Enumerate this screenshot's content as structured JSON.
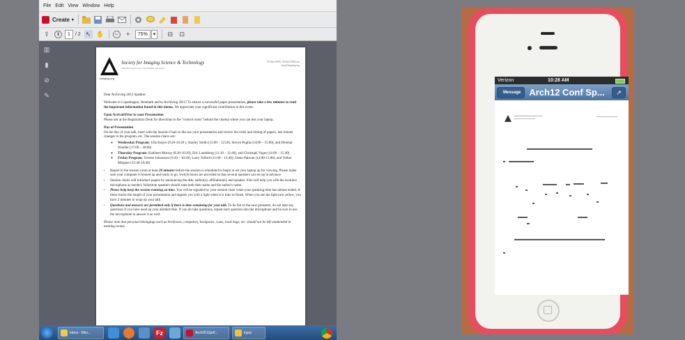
{
  "viewer": {
    "menu": [
      "File",
      "Edit",
      "View",
      "Window",
      "Help"
    ],
    "create_label": "Create",
    "page_current": "1",
    "page_total": "/ 2",
    "zoom": "75%"
  },
  "document": {
    "org_name": "Society for Imaging Science & Technology",
    "org_address": "7003 Kilworth Lane ▪ Springfield, VA 22151",
    "logo_text": "imaging.org",
    "contact_line1": "703/642-9090, 703/642-9094 fax",
    "contact_line2": "info@imaging.org",
    "salutation": "Dear Archiving 2012 Speaker:",
    "intro_pre": "Welcome to Copenhagen, Denmark and to Archiving 2012! To ensure a successful paper presentation, ",
    "intro_bold": "please take a few minutes to read the important information found in this memo.",
    "intro_post": " We appreciate your significant contribution to this event.",
    "arrival_heading": "Upon Arrival/Prior to your Presentation",
    "arrival_text": "Please ask at the Registration Desk for directions to the \"control room\" behind the cinema where you can test your laptop.",
    "day_heading": "Day of Presentation",
    "day_text": "On the day of your talk, meet with the Session Chair to discuss your presentation and review the order and timing of papers, last minute changes to the program, etc. The session chairs are:",
    "programs": [
      {
        "label": "Wednesday Program",
        "text": ": Ulla Kejser (9:20-10:20 ), Stanley Smith (11:00 – 12:20), Steven Puglia (14:00 – 15:00), and Dietmar Wueller (17:00 – 18:00)"
      },
      {
        "label": "Thursday Program",
        "text": ": Kathleen Murray (8:20-10:20), Eric Landsberg (11:10 – 12:40), and Christoph Voges (14:00 – 15:40)"
      },
      {
        "label": "Friday Program",
        "text": ": Torsten Johansson (9:20 – 10:20), Larry Telford (11:00 – 12:40), Osmo Paloran (14:00-15:00), and Volker Märgner (15:40-16:40)"
      }
    ],
    "bullet1_pre": "Report to the session room at least ",
    "bullet1_em": "20 minutes",
    "bullet1_post": " before the session is scheduled to begin to set your laptop up for viewing. Please make sure your computer is booted up and ready to go. Switch boxes are provided so that several speakers can set up in advance.",
    "bullet2": "Session chairs will introduce papers by announcing the title, author(s), affiliation(s), and speaker. S/he will help you with the lavaliere microphone as needed. Substitute speakers should state both their name and the author's name.",
    "bullet3_em": "Please help keep the session running on time.",
    "bullet3_post": " You will be signaled by your session chair when your speaking time has almost ended. A timer tracks the length of your presentation and signals you with a light when it is time to finish. When you see the light turn yellow, you have 2 minutes to wrap up your talk.",
    "bullet4_em": "Questions and answers are permitted only if there is time remaining for your talk.",
    "bullet4_post": " To be fair to the next presenter, do not take any questions if you have used up your allotted time. If you do take questions, repeat each question into the microphone and be sure to use the microphone to answer it as well.",
    "footnote": "Please note that personal belongings such as briefcases, computers, backpacks, coats, book bags, etc. should not be left unattended in meeting rooms."
  },
  "taskbar": {
    "inbox_label": "Inbox - Micr...",
    "arch_label": "Arch2012pdf...",
    "input_label": "input"
  },
  "phone": {
    "carrier": "Verizon",
    "time": "10:28 AM",
    "back_label": "Message",
    "title": "Arch12 Conf Sp..."
  }
}
